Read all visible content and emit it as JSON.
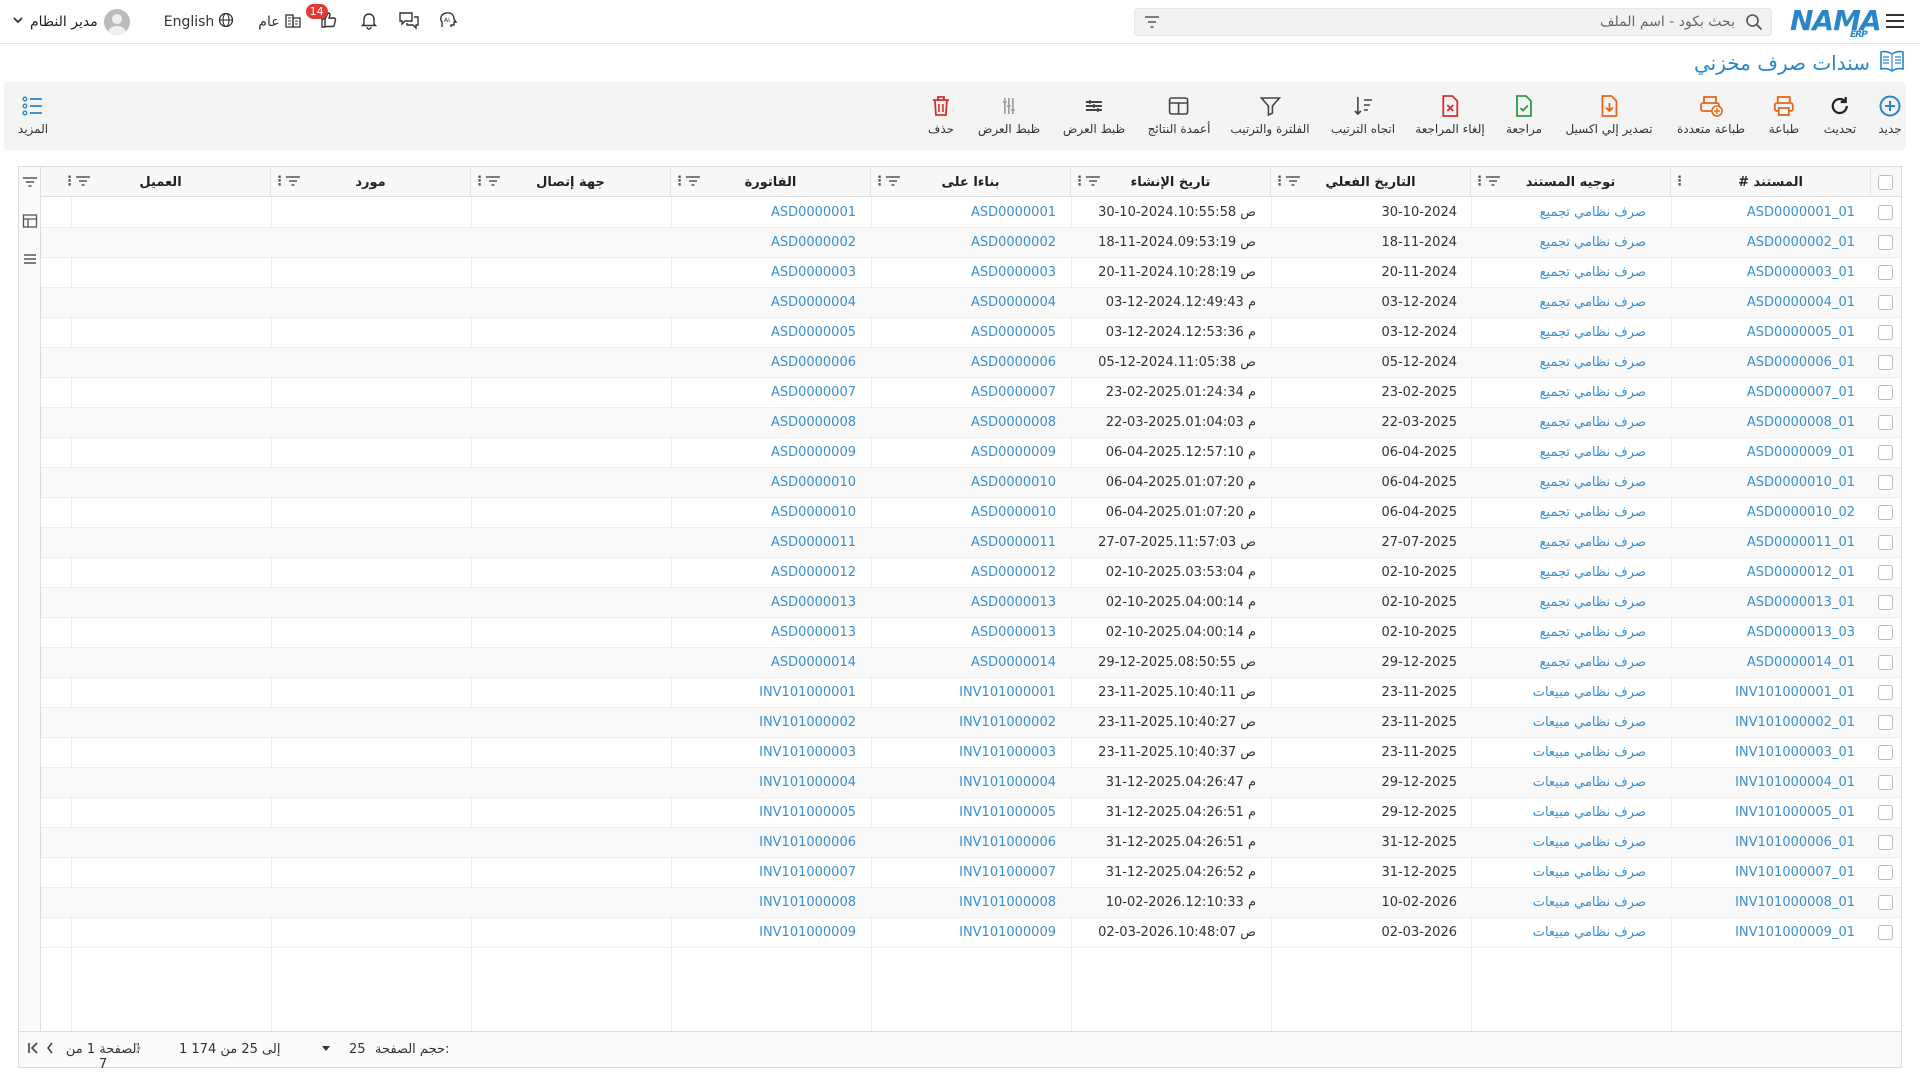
{
  "topbar": {
    "user_name": "مدير النظام",
    "language": "English",
    "org_label": "عام",
    "likes_badge": "14",
    "search_placeholder": "بحث بكود - اسم الملف",
    "logo_text": "NAMA",
    "logo_sub": "ERP"
  },
  "page_title": "سندات صرف مخزني",
  "toolbar": {
    "new": "جديد",
    "refresh": "تحديث",
    "print": "طباعة",
    "multi_print": "طباعة متعددة",
    "export_excel": "تصدير إلي اكسيل",
    "review": "مراجعة",
    "cancel_review": "إلغاء المراجعة",
    "sort_direction": "اتجاه الترتيب",
    "filter_sort": "الفلترة والترتيب",
    "result_columns": "أعمدة النتائج",
    "display_setting_1": "ظبط العرض",
    "display_setting_2": "ظبط العرض",
    "delete": "حذف",
    "more": "المزيد"
  },
  "columns": {
    "doc": "# المستند",
    "direction": "توجيه المستند",
    "actual_date": "التاريخ الفعلي",
    "created": "تاريخ الإنشاء",
    "based_on": "بناءا على",
    "invoice": "الفاتورة",
    "contact": "جهة إتصال",
    "supplier": "مورد",
    "customer": "العميل"
  },
  "rows": [
    {
      "doc": "ASD0000001_01",
      "dir": "صرف نظامي تجميع",
      "date": "30-10-2024",
      "created": "30-10-2024.10:55:58 ص",
      "based": "ASD0000001",
      "inv": "ASD0000001"
    },
    {
      "doc": "ASD0000002_01",
      "dir": "صرف نظامي تجميع",
      "date": "18-11-2024",
      "created": "18-11-2024.09:53:19 ص",
      "based": "ASD0000002",
      "inv": "ASD0000002"
    },
    {
      "doc": "ASD0000003_01",
      "dir": "صرف نظامي تجميع",
      "date": "20-11-2024",
      "created": "20-11-2024.10:28:19 ص",
      "based": "ASD0000003",
      "inv": "ASD0000003"
    },
    {
      "doc": "ASD0000004_01",
      "dir": "صرف نظامي تجميع",
      "date": "03-12-2024",
      "created": "03-12-2024.12:49:43 م",
      "based": "ASD0000004",
      "inv": "ASD0000004"
    },
    {
      "doc": "ASD0000005_01",
      "dir": "صرف نظامي تجميع",
      "date": "03-12-2024",
      "created": "03-12-2024.12:53:36 م",
      "based": "ASD0000005",
      "inv": "ASD0000005"
    },
    {
      "doc": "ASD0000006_01",
      "dir": "صرف نظامي تجميع",
      "date": "05-12-2024",
      "created": "05-12-2024.11:05:38 ص",
      "based": "ASD0000006",
      "inv": "ASD0000006"
    },
    {
      "doc": "ASD0000007_01",
      "dir": "صرف نظامي تجميع",
      "date": "23-02-2025",
      "created": "23-02-2025.01:24:34 م",
      "based": "ASD0000007",
      "inv": "ASD0000007"
    },
    {
      "doc": "ASD0000008_01",
      "dir": "صرف نظامي تجميع",
      "date": "22-03-2025",
      "created": "22-03-2025.01:04:03 م",
      "based": "ASD0000008",
      "inv": "ASD0000008"
    },
    {
      "doc": "ASD0000009_01",
      "dir": "صرف نظامي تجميع",
      "date": "06-04-2025",
      "created": "06-04-2025.12:57:10 م",
      "based": "ASD0000009",
      "inv": "ASD0000009"
    },
    {
      "doc": "ASD0000010_01",
      "dir": "صرف نظامي تجميع",
      "date": "06-04-2025",
      "created": "06-04-2025.01:07:20 م",
      "based": "ASD0000010",
      "inv": "ASD0000010"
    },
    {
      "doc": "ASD0000010_02",
      "dir": "صرف نظامي تجميع",
      "date": "06-04-2025",
      "created": "06-04-2025.01:07:20 م",
      "based": "ASD0000010",
      "inv": "ASD0000010"
    },
    {
      "doc": "ASD0000011_01",
      "dir": "صرف نظامي تجميع",
      "date": "27-07-2025",
      "created": "27-07-2025.11:57:03 ص",
      "based": "ASD0000011",
      "inv": "ASD0000011"
    },
    {
      "doc": "ASD0000012_01",
      "dir": "صرف نظامي تجميع",
      "date": "02-10-2025",
      "created": "02-10-2025.03:53:04 م",
      "based": "ASD0000012",
      "inv": "ASD0000012"
    },
    {
      "doc": "ASD0000013_01",
      "dir": "صرف نظامي تجميع",
      "date": "02-10-2025",
      "created": "02-10-2025.04:00:14 م",
      "based": "ASD0000013",
      "inv": "ASD0000013"
    },
    {
      "doc": "ASD0000013_03",
      "dir": "صرف نظامي تجميع",
      "date": "02-10-2025",
      "created": "02-10-2025.04:00:14 م",
      "based": "ASD0000013",
      "inv": "ASD0000013"
    },
    {
      "doc": "ASD0000014_01",
      "dir": "صرف نظامي تجميع",
      "date": "29-12-2025",
      "created": "29-12-2025.08:50:55 ص",
      "based": "ASD0000014",
      "inv": "ASD0000014"
    },
    {
      "doc": "INV101000001_01",
      "dir": "صرف نظامي مبيعات",
      "date": "23-11-2025",
      "created": "23-11-2025.10:40:11 ص",
      "based": "INV101000001",
      "inv": "INV101000001"
    },
    {
      "doc": "INV101000002_01",
      "dir": "صرف نظامي مبيعات",
      "date": "23-11-2025",
      "created": "23-11-2025.10:40:27 ص",
      "based": "INV101000002",
      "inv": "INV101000002"
    },
    {
      "doc": "INV101000003_01",
      "dir": "صرف نظامي مبيعات",
      "date": "23-11-2025",
      "created": "23-11-2025.10:40:37 ص",
      "based": "INV101000003",
      "inv": "INV101000003"
    },
    {
      "doc": "INV101000004_01",
      "dir": "صرف نظامي مبيعات",
      "date": "29-12-2025",
      "created": "31-12-2025.04:26:47 م",
      "based": "INV101000004",
      "inv": "INV101000004"
    },
    {
      "doc": "INV101000005_01",
      "dir": "صرف نظامي مبيعات",
      "date": "29-12-2025",
      "created": "31-12-2025.04:26:51 م",
      "based": "INV101000005",
      "inv": "INV101000005"
    },
    {
      "doc": "INV101000006_01",
      "dir": "صرف نظامي مبيعات",
      "date": "31-12-2025",
      "created": "31-12-2025.04:26:51 م",
      "based": "INV101000006",
      "inv": "INV101000006"
    },
    {
      "doc": "INV101000007_01",
      "dir": "صرف نظامي مبيعات",
      "date": "31-12-2025",
      "created": "31-12-2025.04:26:52 م",
      "based": "INV101000007",
      "inv": "INV101000007"
    },
    {
      "doc": "INV101000008_01",
      "dir": "صرف نظامي مبيعات",
      "date": "10-02-2026",
      "created": "10-02-2026.12:10:33 م",
      "based": "INV101000008",
      "inv": "INV101000008"
    },
    {
      "doc": "INV101000009_01",
      "dir": "صرف نظامي مبيعات",
      "date": "02-03-2026",
      "created": "02-03-2026.10:48:07 ص",
      "based": "INV101000009",
      "inv": "INV101000009"
    }
  ],
  "footer": {
    "page_size_label": "حجم الصفحة:",
    "page_size": "25",
    "range_text": "1 إلى 25 من 174",
    "page_text": "الصفحة 1 من 7"
  },
  "colors": {
    "accent": "#2a86c8",
    "link": "#3b8fcf",
    "badge": "#e53935"
  }
}
